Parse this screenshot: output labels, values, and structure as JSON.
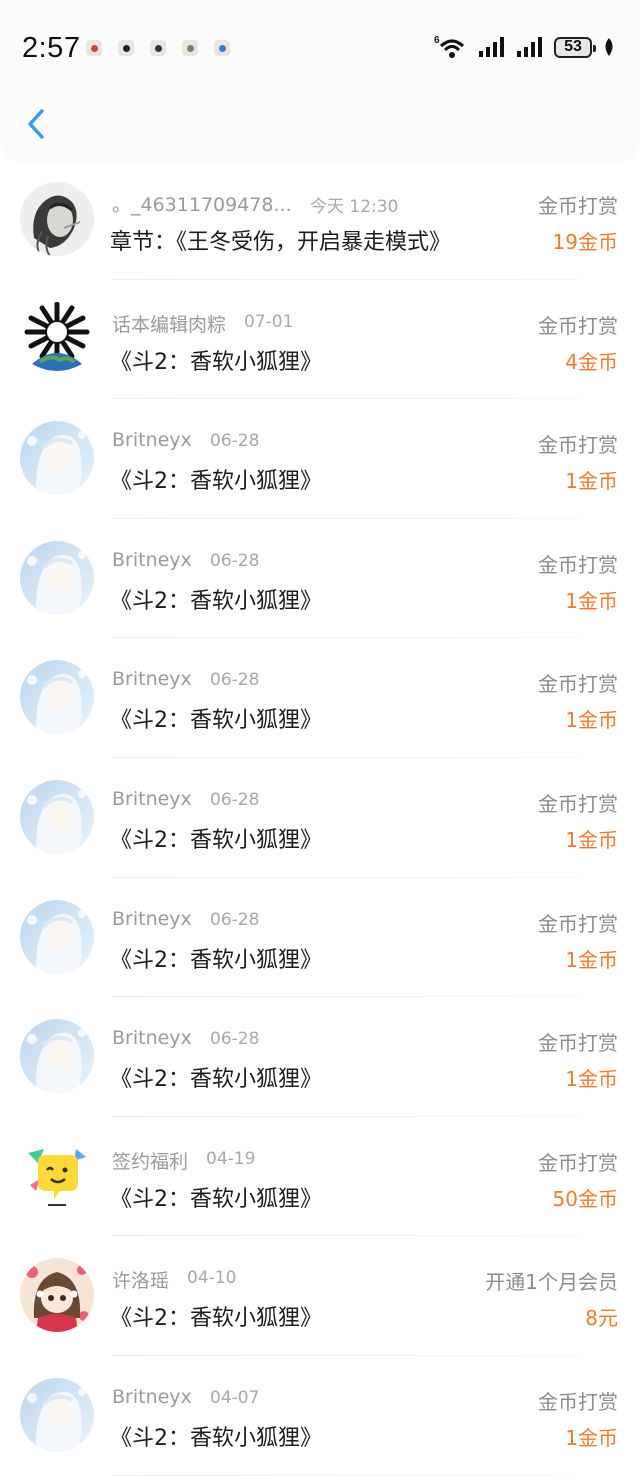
{
  "status_bar": {
    "time": "2:57",
    "notification_icons": [
      "app-notification-icon",
      "app-notification-icon",
      "app-notification-icon",
      "app-notification-icon",
      "app-notification-icon"
    ],
    "network_label": "6",
    "battery": "53"
  },
  "header": {
    "back_icon": "chevron-left-icon"
  },
  "colors": {
    "accent_blue": "#3a9af0",
    "amount_orange": "#f07a2e"
  },
  "records": [
    {
      "user": "。_46311709478...",
      "date": "今天 12:30",
      "title": "章节：《王冬受伤，开启暴走模式》",
      "type": "金币打赏",
      "amount": "19金币",
      "avatar": "sketch"
    },
    {
      "user": "话本编辑肉粽",
      "date": "07-01",
      "title": "《斗2：香软小狐狸》",
      "type": "金币打赏",
      "amount": "4金币",
      "avatar": "globe"
    },
    {
      "user": "Britneyx",
      "date": "06-28",
      "title": "《斗2：香软小狐狸》",
      "type": "金币打赏",
      "amount": "1金币",
      "avatar": "white-hair"
    },
    {
      "user": "Britneyx",
      "date": "06-28",
      "title": "《斗2：香软小狐狸》",
      "type": "金币打赏",
      "amount": "1金币",
      "avatar": "white-hair"
    },
    {
      "user": "Britneyx",
      "date": "06-28",
      "title": "《斗2：香软小狐狸》",
      "type": "金币打赏",
      "amount": "1金币",
      "avatar": "white-hair"
    },
    {
      "user": "Britneyx",
      "date": "06-28",
      "title": "《斗2：香软小狐狸》",
      "type": "金币打赏",
      "amount": "1金币",
      "avatar": "white-hair"
    },
    {
      "user": "Britneyx",
      "date": "06-28",
      "title": "《斗2：香软小狐狸》",
      "type": "金币打赏",
      "amount": "1金币",
      "avatar": "white-hair"
    },
    {
      "user": "Britneyx",
      "date": "06-28",
      "title": "《斗2：香软小狐狸》",
      "type": "金币打赏",
      "amount": "1金币",
      "avatar": "white-hair"
    },
    {
      "user": "签约福利",
      "date": "04-19",
      "title": "《斗2：香软小狐狸》",
      "type": "金币打赏",
      "amount": "50金币",
      "avatar": "emoji"
    },
    {
      "user": "许洛瑶",
      "date": "04-10",
      "title": "《斗2：香软小狐狸》",
      "type": "开通1个月会员",
      "amount": "8元",
      "avatar": "anime-girl"
    },
    {
      "user": "Britneyx",
      "date": "04-07",
      "title": "《斗2：香软小狐狸》",
      "type": "金币打赏",
      "amount": "1金币",
      "avatar": "white-hair"
    }
  ]
}
